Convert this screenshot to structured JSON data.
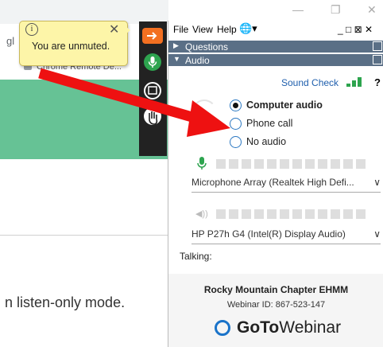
{
  "browser": {
    "tab_fragment": "gl",
    "bookmark_label": "Chrome Remote De...",
    "listen_text": "n listen-only mode."
  },
  "window_controls": {
    "minimize": "—",
    "restore": "❐",
    "close": "✕"
  },
  "tooltip": {
    "info_glyph": "i",
    "message": "You are unmuted.",
    "close_glyph": "✕"
  },
  "strip_buttons": [
    {
      "icon": "arrow-right-icon",
      "color": "#f37021"
    },
    {
      "icon": "microphone-icon",
      "color": "#2ea44f"
    },
    {
      "icon": "screen-icon",
      "color": "#222222"
    },
    {
      "icon": "raise-hand-icon",
      "color": "#222222"
    }
  ],
  "menubar": {
    "file": "File",
    "view": "View",
    "help": "Help",
    "globe": "🌐▾",
    "controls": "_ □ ⊠ ✕"
  },
  "sections": {
    "questions": "Questions",
    "audio": "Audio"
  },
  "audio": {
    "sound_check": "Sound Check",
    "help_glyph": "?",
    "options": [
      {
        "label": "Computer audio",
        "selected": true
      },
      {
        "label": "Phone call",
        "selected": false
      },
      {
        "label": "No audio",
        "selected": false
      }
    ],
    "microphone_device": "Microphone Array (Realtek High Defi...",
    "speaker_device": "HP P27h G4 (Intel(R) Display Audio)",
    "talking_label": "Talking:"
  },
  "webinar": {
    "org_name": "Rocky Mountain Chapter EHMM",
    "webinar_id": "Webinar ID: 867-523-147",
    "logo_bold": "GoTo",
    "logo_light": "Webinar"
  },
  "colors": {
    "accent_blue": "#1f5fad",
    "section_bar": "#5a6f86",
    "green": "#2ea44f",
    "arrow_red": "#ee1111",
    "tooltip_bg": "#fdf5a8"
  }
}
